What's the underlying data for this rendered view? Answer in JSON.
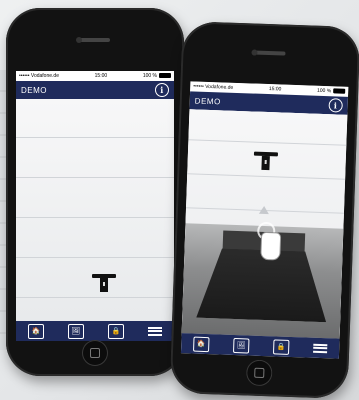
{
  "left_phone": {
    "status": {
      "carrier": "•••••• Vodafone.de",
      "time": "15:00",
      "battery": "100 %"
    },
    "app_title": "DEMO",
    "info_label": "i",
    "tabs": [
      "🏠",
      "🖼",
      "🔒",
      "☰"
    ]
  },
  "right_phone": {
    "status": {
      "carrier": "•••••• Vodafone.de",
      "time": "15:00",
      "battery": "100 %"
    },
    "app_title": "DEMO",
    "info_label": "i",
    "tabs": [
      "🏠",
      "🖼",
      "🔒",
      "☰"
    ]
  },
  "accent_color": "#1f2b5c"
}
